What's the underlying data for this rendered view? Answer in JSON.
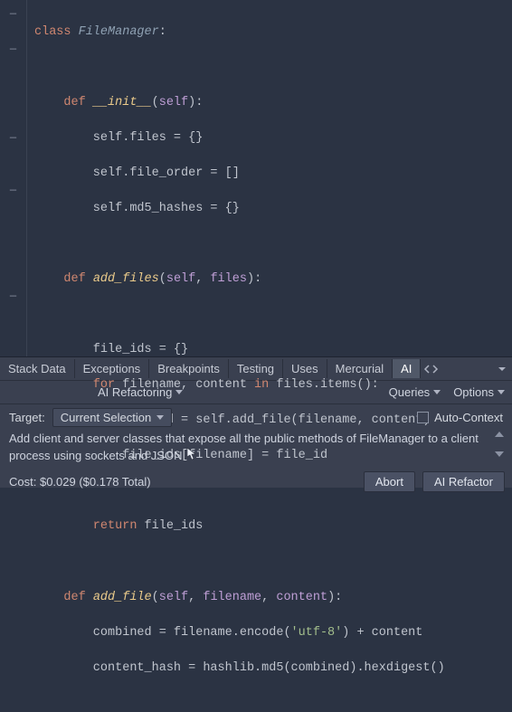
{
  "code": {
    "l1": {
      "a": "class ",
      "b": "FileManager",
      "c": ":"
    },
    "l3": {
      "a": "    def ",
      "b": "__init__",
      "c": "(",
      "d": "self",
      "e": "):"
    },
    "l4": "        self.files = {}",
    "l5": "        self.file_order = []",
    "l6": "        self.md5_hashes = {}",
    "l8": {
      "a": "    def ",
      "b": "add_files",
      "c": "(",
      "d": "self",
      "e": ", ",
      "f": "files",
      "g": "):"
    },
    "l10": "        file_ids = {}",
    "l11": {
      "a": "        for ",
      "b": "filename, content ",
      "c": "in ",
      "d": "files.items():"
    },
    "l12": "            file_id = self.add_file(filename, content)",
    "l13": "            file_ids[filename] = file_id",
    "l15": {
      "a": "        return ",
      "b": "file_ids"
    },
    "l17": {
      "a": "    def ",
      "b": "add_file",
      "c": "(",
      "d": "self",
      "e": ", ",
      "f": "filename",
      "g": ", ",
      "h": "content",
      "i": "):"
    },
    "l18": {
      "a": "        combined = filename.encode(",
      "b": "'utf-8'",
      "c": ") + content"
    },
    "l19": "        content_hash = hashlib.md5(combined).hexdigest()"
  },
  "tabs": {
    "stack": "Stack Data",
    "exceptions": "Exceptions",
    "breakpoints": "Breakpoints",
    "testing": "Testing",
    "uses": "Uses",
    "mercurial": "Mercurial",
    "ai": "AI"
  },
  "toolbar": {
    "refactoring": "AI Refactoring",
    "queries": "Queries",
    "options": "Options"
  },
  "target": {
    "label": "Target:",
    "value": "Current Selection",
    "autocontext": "Auto-Context"
  },
  "prompt": {
    "text": "Add client and server classes that expose all the public methods of FileManager to a client process using sockets and JSON"
  },
  "actions": {
    "cost_label": "Cost:",
    "cost_value": "$0.029 ($0.178 Total)",
    "abort": "Abort",
    "refactor": "AI Refactor"
  }
}
